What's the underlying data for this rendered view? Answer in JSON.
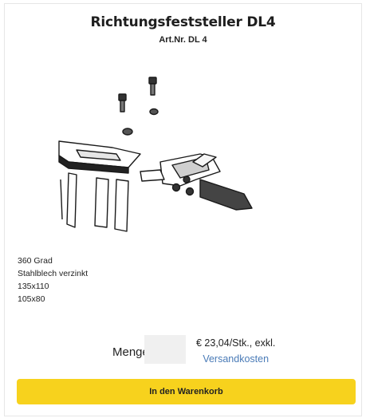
{
  "product": {
    "title": "Richtungsfeststeller DL4",
    "article_number": "Art.Nr. DL 4",
    "image_icon": "caster-brake-illustration",
    "specs": [
      "360 Grad",
      "Stahlblech verzinkt",
      "135x110",
      "105x80"
    ]
  },
  "order": {
    "quantity_label": "Menge",
    "quantity_value": "",
    "price_text": "€ 23,04/Stk., exkl.",
    "shipping_link": "Versandkosten",
    "cart_button": "In den Warenkorb"
  },
  "colors": {
    "button_bg": "#f7d21d",
    "link": "#4a7bb7",
    "input_bg": "#f0f0f0"
  }
}
